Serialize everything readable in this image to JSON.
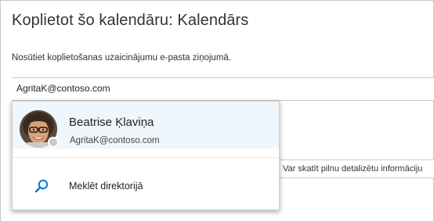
{
  "dialog": {
    "title": "Koplietot šo kalendāru: Kalendārs",
    "instruction": "Nosūtiet koplietošanas uzaicinājumu e-pasta ziņojumā."
  },
  "email_field": {
    "value": "AgritaK@contoso.com"
  },
  "permission_select": {
    "selected": "Var skatīt pilnu detalizētu informāciju"
  },
  "suggestions": {
    "person": {
      "name": "Beatrise Ķlaviņa",
      "email": "AgritaK@contoso.com",
      "presence": "offline"
    },
    "search_directory_label": "Meklēt direktorijā"
  },
  "colors": {
    "highlight": "#eff6fc",
    "accent": "#0078d4",
    "presence_offline": "#c8c8c8"
  }
}
